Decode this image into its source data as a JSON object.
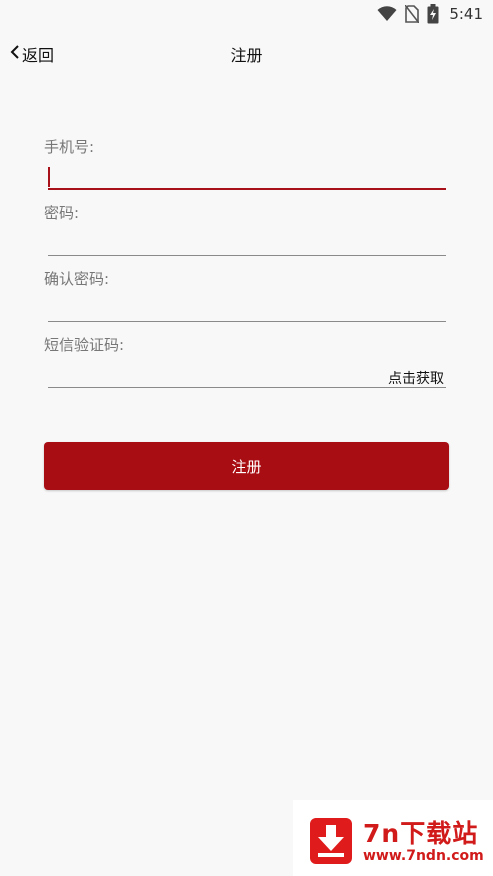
{
  "status_bar": {
    "time": "5:41",
    "icons": [
      "wifi-icon",
      "no-sim-icon",
      "battery-charging-icon"
    ]
  },
  "nav": {
    "back_label": "返回",
    "back_icon": "chevron-left-icon",
    "title": "注册"
  },
  "form": {
    "phone": {
      "label": "手机号:",
      "value": "",
      "placeholder": ""
    },
    "password": {
      "label": "密码:",
      "value": "",
      "placeholder": ""
    },
    "confirm_password": {
      "label": "确认密码:",
      "value": "",
      "placeholder": ""
    },
    "sms_code": {
      "label": "短信验证码:",
      "value": "",
      "placeholder": "",
      "get_code_label": "点击获取"
    }
  },
  "register_button": {
    "label": "注册"
  },
  "colors": {
    "accent": "#a80d14",
    "background": "#f8f8f8"
  },
  "watermark": {
    "title": "7n下载站",
    "url": "www.7ndn.com",
    "icon": "download-arrow-icon"
  }
}
